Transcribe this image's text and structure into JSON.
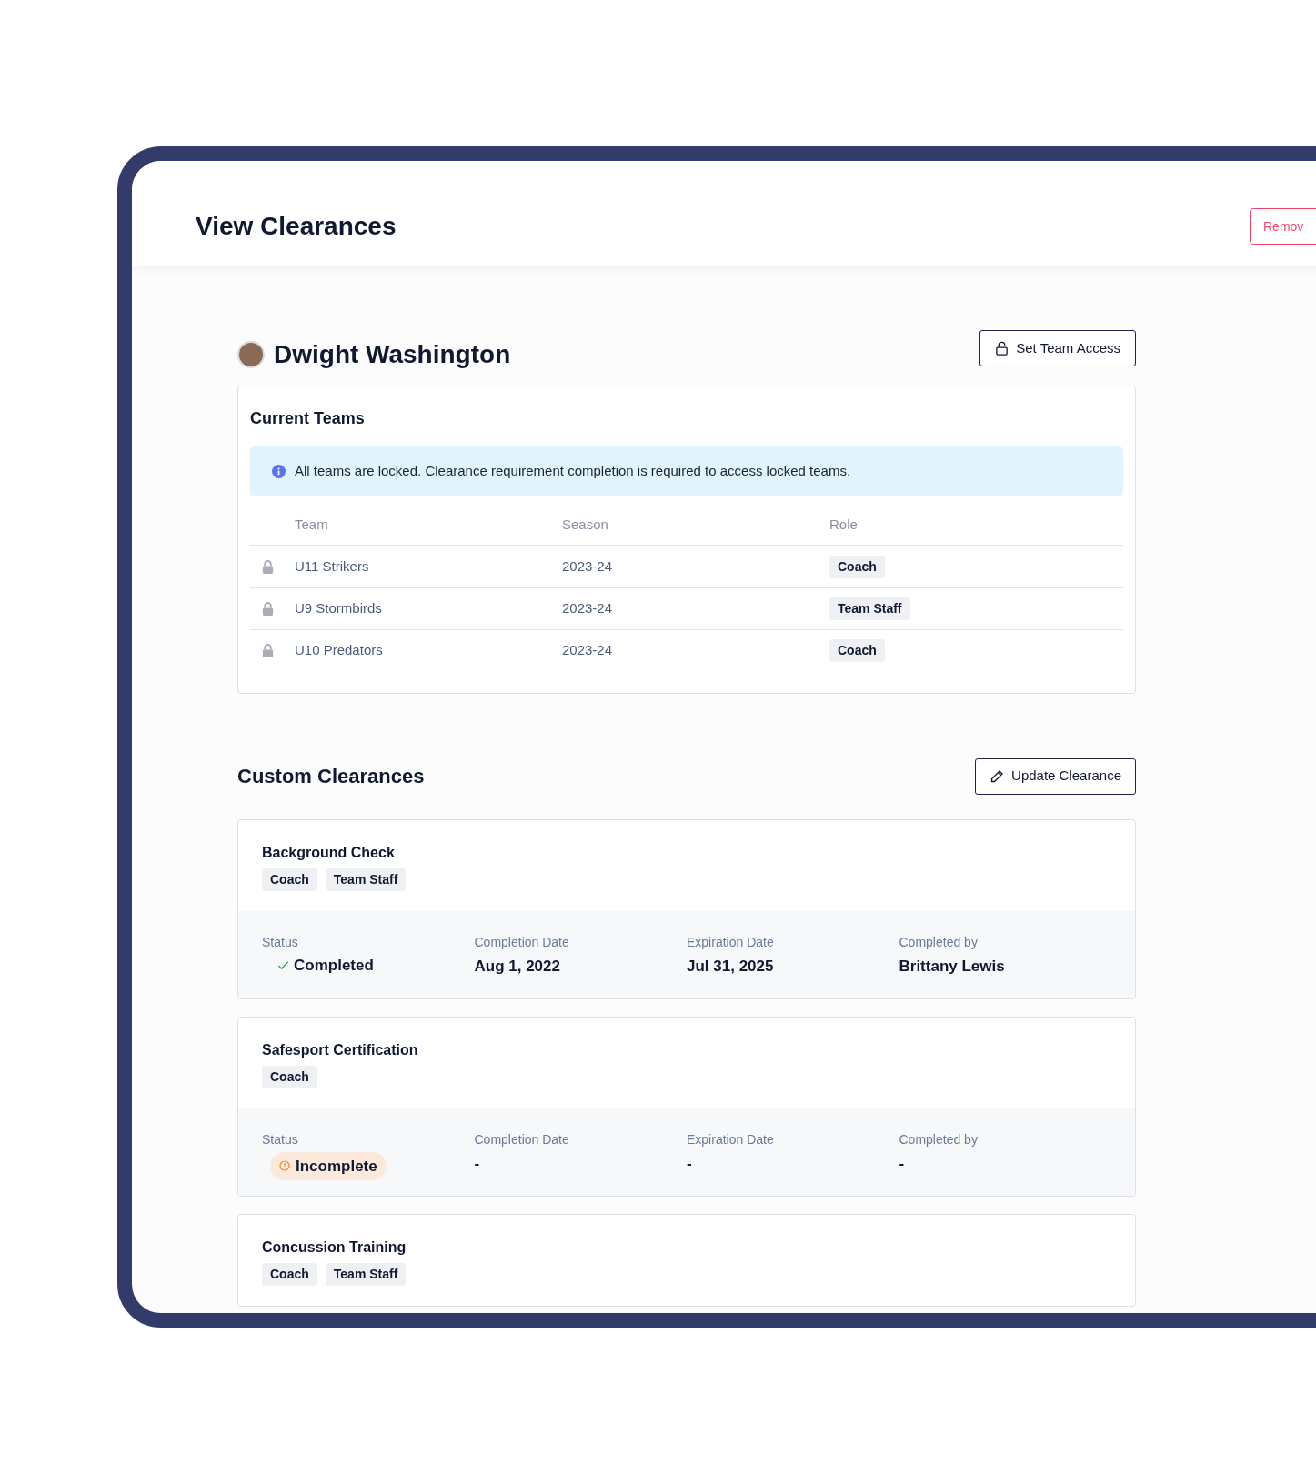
{
  "header": {
    "title": "View Clearances",
    "action": "Remov"
  },
  "person": {
    "name": "Dwight Washington",
    "action": "Set Team Access"
  },
  "current_teams": {
    "title": "Current Teams",
    "notice": "All teams are locked. Clearance requirement completion is required to access locked teams.",
    "columns": [
      "Team",
      "Season",
      "Role"
    ],
    "rows": [
      {
        "locked": true,
        "team": "U11 Strikers",
        "season": "2023-24",
        "role": "Coach"
      },
      {
        "locked": true,
        "team": "U9 Stormbirds",
        "season": "2023-24",
        "role": "Team Staff"
      },
      {
        "locked": true,
        "team": "U10 Predators",
        "season": "2023-24",
        "role": "Coach"
      }
    ]
  },
  "custom_clearances": {
    "title": "Custom Clearances",
    "action": "Update Clearance",
    "items": [
      {
        "name": "Background Check",
        "roles": [
          "Coach",
          "Team Staff"
        ],
        "status": {
          "label": "Status",
          "kind": "completed",
          "text": "Completed"
        },
        "details": [
          {
            "label": "Completion Date",
            "value": "Aug 1, 2022"
          },
          {
            "label": "Expiration Date",
            "value": "Jul 31, 2025"
          },
          {
            "label": "Completed by",
            "value": "Brittany Lewis"
          }
        ]
      },
      {
        "name": "Safesport Certification",
        "roles": [
          "Coach"
        ],
        "status": {
          "label": "Status",
          "kind": "incomplete",
          "text": "Incomplete"
        },
        "details": [
          {
            "label": "Completion Date",
            "value": "-"
          },
          {
            "label": "Expiration Date",
            "value": "-"
          },
          {
            "label": "Completed by",
            "value": "-"
          }
        ]
      },
      {
        "name": "Concussion Training",
        "roles": [
          "Coach",
          "Team Staff"
        ]
      }
    ]
  }
}
